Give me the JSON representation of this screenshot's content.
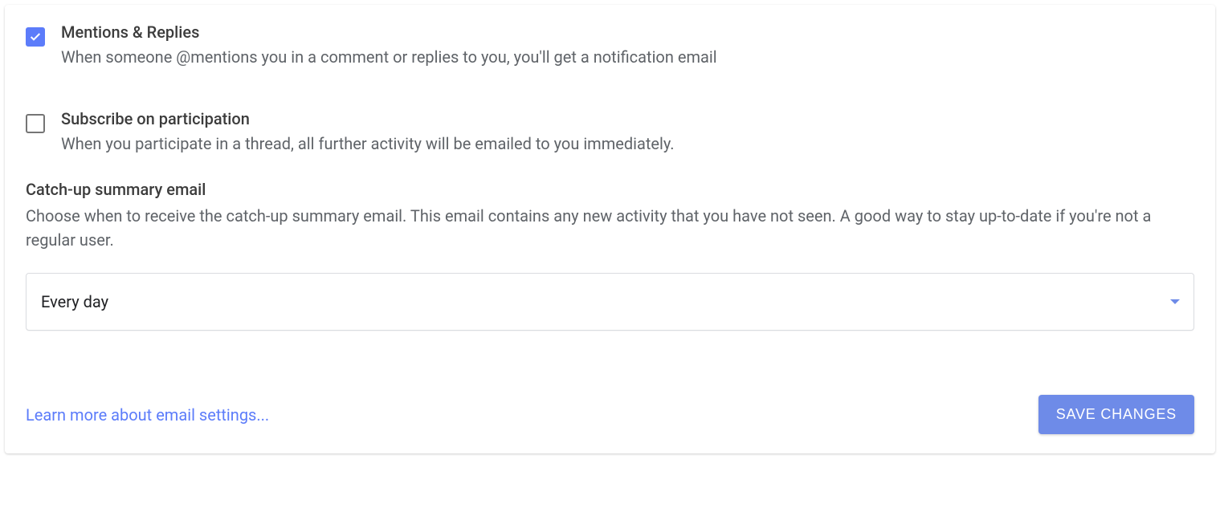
{
  "options": {
    "mentions": {
      "checked": true,
      "title": "Mentions & Replies",
      "desc": "When someone @mentions you in a comment or replies to you, you'll get a notification email"
    },
    "subscribe": {
      "checked": false,
      "title": "Subscribe on participation",
      "desc": "When you participate in a thread, all further activity will be emailed to you immediately."
    }
  },
  "catchup": {
    "title": "Catch-up summary email",
    "desc": "Choose when to receive the catch-up summary email. This email contains any new activity that you have not seen. A good way to stay up-to-date if you're not a regular user.",
    "selected": "Every day"
  },
  "footer": {
    "learn_more": "Learn more about email settings...",
    "save_label": "SAVE CHANGES"
  },
  "colors": {
    "accent": "#6e8be8",
    "checkbox": "#5c7cfa"
  }
}
